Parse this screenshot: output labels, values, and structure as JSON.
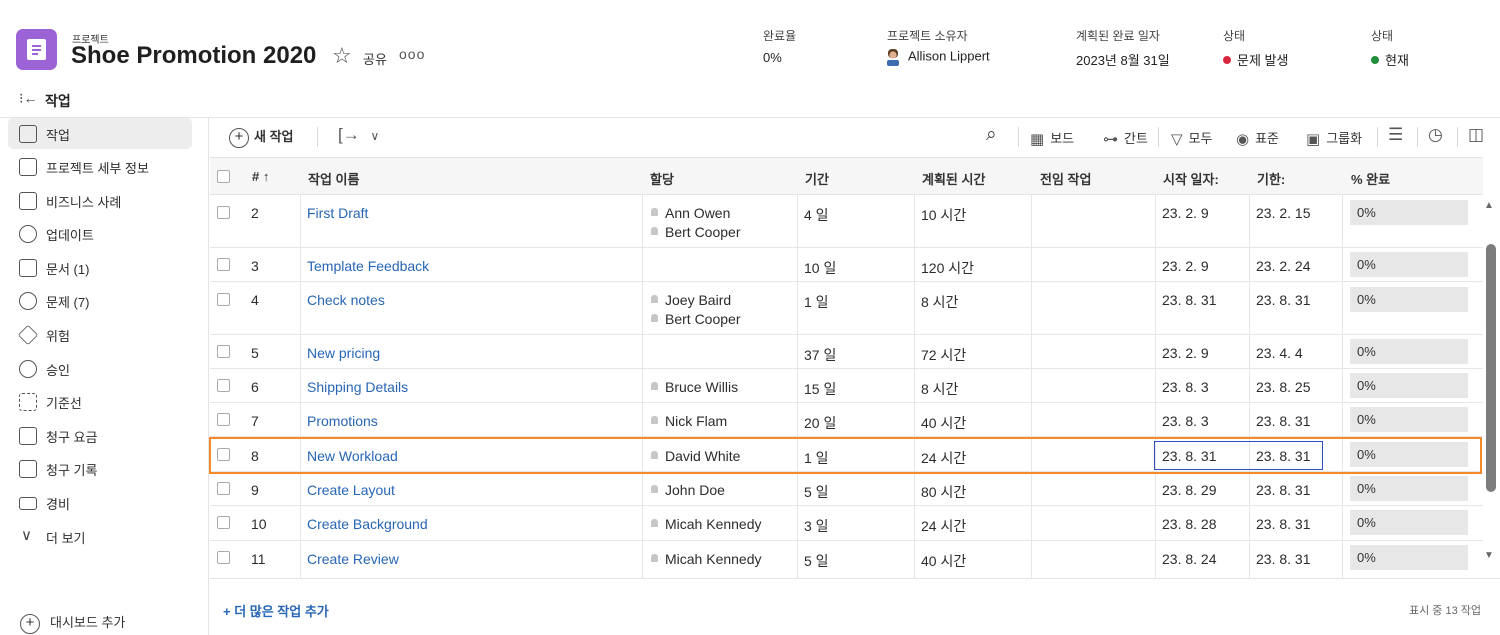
{
  "header": {
    "kicker": "프로젝트",
    "title": "Shoe Promotion 2020",
    "share_label": "공유",
    "more_label": "ooo",
    "meta": [
      {
        "label": "완료율",
        "value": "0%"
      },
      {
        "label": "프로젝트 소유자",
        "value": "Allison Lippert"
      },
      {
        "label": "계획된 완료 일자",
        "value": "2023년 8월 31일"
      },
      {
        "label": "상태",
        "value": "문제 발생",
        "dot_color": "#d7263d"
      },
      {
        "label": "상태",
        "value": "현재",
        "dot_color": "#1f8f3a"
      }
    ]
  },
  "subheader": {
    "collapse_icon": "collapse-panel-icon",
    "title": "작업"
  },
  "sidebar": {
    "items": [
      {
        "label": "작업",
        "icon": "task-clipboard-icon",
        "active": true
      },
      {
        "label": "프로젝트 세부 정보",
        "icon": "details-icon"
      },
      {
        "label": "비즈니스 사례",
        "icon": "business-case-icon"
      },
      {
        "label": "업데이트",
        "icon": "update-bubble-icon"
      },
      {
        "label": "문서 (1)",
        "icon": "document-icon"
      },
      {
        "label": "문제 (7)",
        "icon": "issue-icon"
      },
      {
        "label": "위험",
        "icon": "risk-icon"
      },
      {
        "label": "승인",
        "icon": "approval-icon"
      },
      {
        "label": "기준선",
        "icon": "baseline-icon"
      },
      {
        "label": "청구 요금",
        "icon": "billing-rate-icon"
      },
      {
        "label": "청구 기록",
        "icon": "billing-record-icon"
      },
      {
        "label": "경비",
        "icon": "expense-icon"
      },
      {
        "label": "더 보기",
        "icon": "chevron-down-icon"
      }
    ],
    "add_dashboard": "대시보드 추가"
  },
  "toolbar": {
    "new_task": "새 작업",
    "board": "보드",
    "gantt": "간트",
    "filter": "모두",
    "view": "표준",
    "group": "그룹화"
  },
  "table": {
    "columns": [
      "#",
      "작업 이름",
      "할당",
      "기간",
      "계획된 시간",
      "전임 작업",
      "시작 일자:",
      "기한:",
      "% 완료"
    ],
    "rows": [
      {
        "num": "2",
        "name": "First Draft",
        "assign": [
          "Ann Owen",
          "Bert Cooper"
        ],
        "duration": "4 일",
        "planned": "10 시간",
        "pred": "",
        "start": "23. 2. 9",
        "due": "23. 2. 15",
        "pct": "0%"
      },
      {
        "num": "3",
        "name": "Template Feedback",
        "assign": [],
        "duration": "10 일",
        "planned": "120 시간",
        "pred": "",
        "start": "23. 2. 9",
        "due": "23. 2. 24",
        "pct": "0%"
      },
      {
        "num": "4",
        "name": "Check notes",
        "assign": [
          "Joey Baird",
          "Bert Cooper"
        ],
        "duration": "1 일",
        "planned": "8 시간",
        "pred": "",
        "start": "23. 8. 31",
        "due": "23. 8. 31",
        "pct": "0%"
      },
      {
        "num": "5",
        "name": "New pricing",
        "assign": [],
        "duration": "37 일",
        "planned": "72 시간",
        "pred": "",
        "start": "23. 2. 9",
        "due": "23. 4. 4",
        "pct": "0%"
      },
      {
        "num": "6",
        "name": "Shipping Details",
        "assign": [
          "Bruce Willis"
        ],
        "duration": "15 일",
        "planned": "8 시간",
        "pred": "",
        "start": "23. 8. 3",
        "due": "23. 8. 25",
        "pct": "0%"
      },
      {
        "num": "7",
        "name": "Promotions",
        "assign": [
          "Nick Flam"
        ],
        "duration": "20 일",
        "planned": "40 시간",
        "pred": "",
        "start": "23. 8. 3",
        "due": "23. 8. 31",
        "pct": "0%"
      },
      {
        "num": "8",
        "name": "New Workload",
        "assign": [
          "David White"
        ],
        "duration": "1 일",
        "planned": "24 시간",
        "pred": "",
        "start": "23. 8. 31",
        "due": "23. 8. 31",
        "pct": "0%"
      },
      {
        "num": "9",
        "name": "Create Layout",
        "assign": [
          "John Doe"
        ],
        "duration": "5 일",
        "planned": "80 시간",
        "pred": "",
        "start": "23. 8. 29",
        "due": "23. 8. 31",
        "pct": "0%"
      },
      {
        "num": "10",
        "name": "Create Background",
        "assign": [
          "Micah Kennedy"
        ],
        "duration": "3 일",
        "planned": "24 시간",
        "pred": "",
        "start": "23. 8. 28",
        "due": "23. 8. 31",
        "pct": "0%"
      },
      {
        "num": "11",
        "name": "Create Review",
        "assign": [
          "Micah Kennedy"
        ],
        "duration": "5 일",
        "planned": "40 시간",
        "pred": "",
        "start": "23. 8. 24",
        "due": "23. 8. 31",
        "pct": "0%"
      }
    ]
  },
  "footer": {
    "add_more": "+ 더 많은 작업 추가",
    "count": "표시 중 13 작업"
  },
  "colors": {
    "brand": "#9b63d6",
    "link": "#2766b6",
    "highlight_row": "#f58a2c",
    "highlight_cell": "#2b4fc4"
  }
}
